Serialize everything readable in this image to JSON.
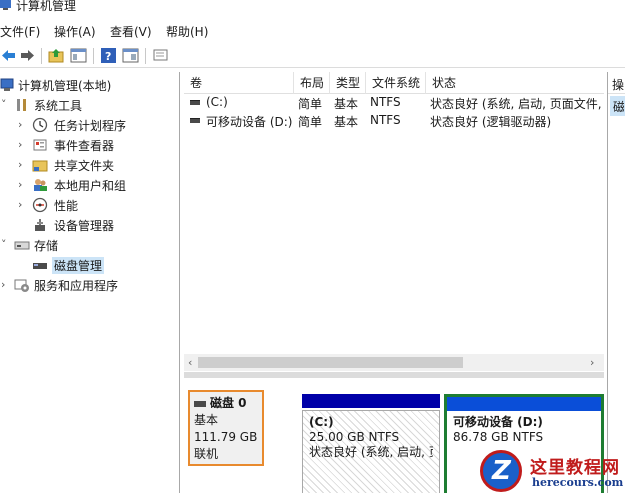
{
  "window": {
    "title": "计算机管理"
  },
  "menu": [
    "文件(F)",
    "操作(A)",
    "查看(V)",
    "帮助(H)"
  ],
  "toolbar": {
    "icons": [
      "back-arrow-icon",
      "forward-arrow-icon",
      "folder-up-icon",
      "show-hide-tree-icon",
      "help-icon",
      "properties-icon",
      "console-icon"
    ]
  },
  "tree": {
    "root": "计算机管理(本地)",
    "system_tools": "系统工具",
    "task_scheduler": "任务计划程序",
    "event_viewer": "事件查看器",
    "shared_folders": "共享文件夹",
    "local_users": "本地用户和组",
    "performance": "性能",
    "device_manager": "设备管理器",
    "storage": "存储",
    "disk_management": "磁盘管理",
    "services_apps": "服务和应用程序"
  },
  "volumes": {
    "columns": [
      "卷",
      "布局",
      "类型",
      "文件系统",
      "状态"
    ],
    "rows": [
      {
        "volume": "(C:)",
        "layout": "简单",
        "type": "基本",
        "fs": "NTFS",
        "status": "状态良好 (系统, 启动, 页面文件,"
      },
      {
        "volume": "可移动设备 (D:)",
        "layout": "简单",
        "type": "基本",
        "fs": "NTFS",
        "status": "状态良好 (逻辑驱动器)"
      }
    ]
  },
  "disk": {
    "name": "磁盘 0",
    "type": "基本",
    "size": "111.79 GB",
    "state": "联机",
    "partitions": [
      {
        "name": "(C:)",
        "size": "25.00 GB NTFS",
        "status": "状态良好 (系统, 启动, 页"
      },
      {
        "name": "可移动设备  (D:)",
        "size": "86.78 GB NTFS"
      }
    ]
  },
  "actions": {
    "header": "操",
    "item": "磁"
  },
  "watermark": {
    "line1": "这里教程网",
    "line2": "herecours.com"
  },
  "colors": {
    "primary_partition": "#0000a8",
    "logical_partition": "#0a4ed8",
    "selection": "#cce4f7",
    "disk_highlight": "#e88a2e",
    "partition_highlight": "#1e7d32"
  }
}
